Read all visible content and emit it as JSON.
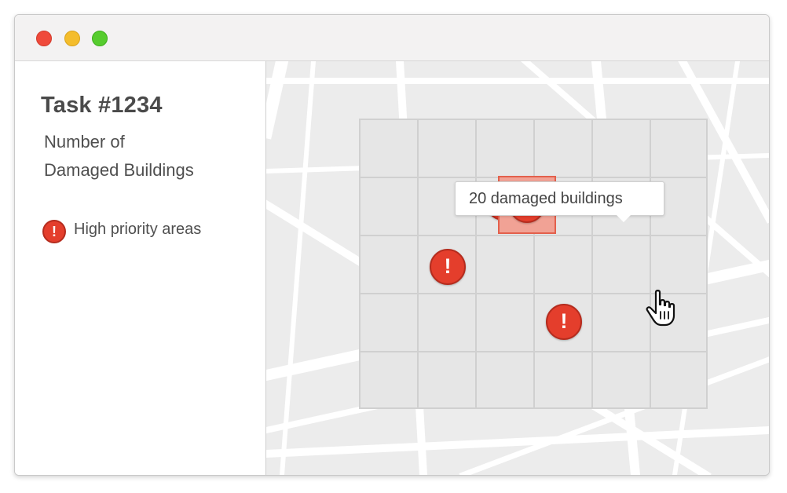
{
  "window": {
    "controls": [
      {
        "name": "close",
        "color": "#ef4a3b"
      },
      {
        "name": "minimize",
        "color": "#f4bd2c"
      },
      {
        "name": "zoom",
        "color": "#56cc2e"
      }
    ]
  },
  "sidebar": {
    "title": "Task #1234",
    "subtitle_line1": "Number of",
    "subtitle_line2": "Damaged Buildings",
    "legend": {
      "icon": "exclamation-alert-icon",
      "icon_glyph": "!",
      "label": "High priority areas"
    }
  },
  "map": {
    "grid_rows": 5,
    "grid_cols": 6,
    "marker_glyph": "!",
    "alert_color": "#e43e2c",
    "tooltip": {
      "text": "20 damaged buildings"
    }
  }
}
